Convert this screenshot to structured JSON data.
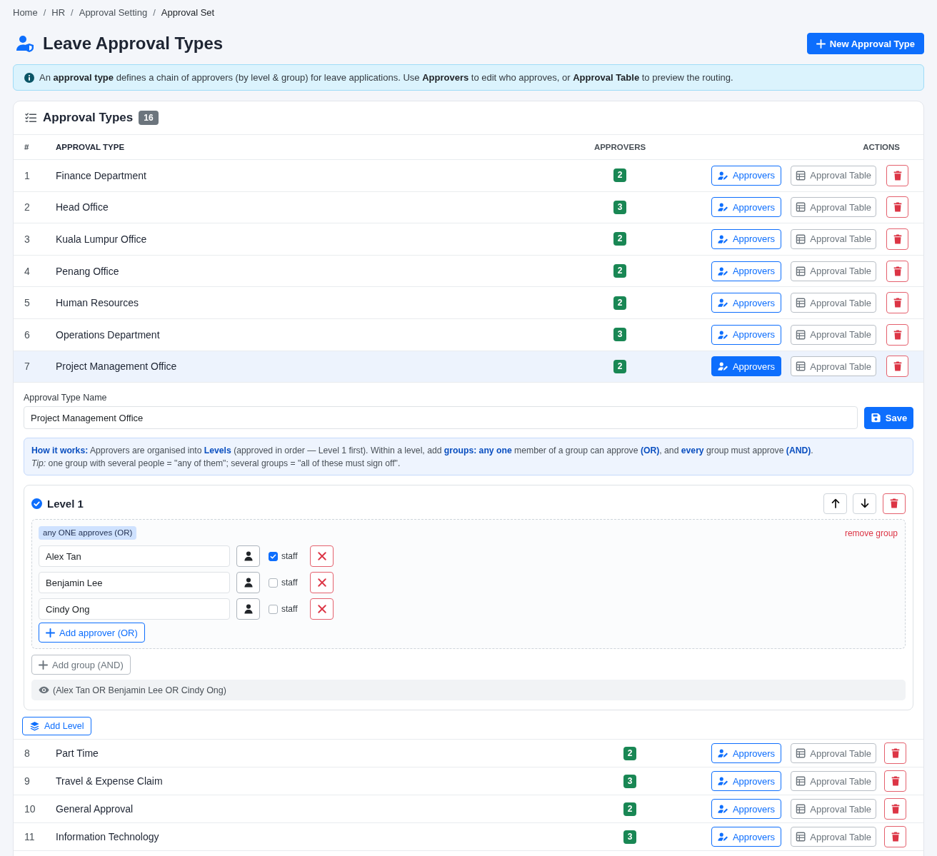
{
  "breadcrumb": {
    "items": [
      "Home",
      "HR",
      "Approval Setting",
      "Approval Set"
    ],
    "separators": [
      "/",
      "/",
      "/"
    ]
  },
  "header": {
    "title": "Leave Approval Types",
    "new_button": "New Approval Type"
  },
  "info_alert": "An **approval type** defines a chain of approvers (by level & group) for leave applications. Use **Approvers** to edit who approves, or **Approval Table** to preview the routing.",
  "card": {
    "title": "Approval Types",
    "count": "16"
  },
  "table": {
    "columns": [
      "#",
      "APPROVAL TYPE",
      "APPROVERS",
      "ACTIONS"
    ],
    "rows": [
      {
        "number": "1",
        "name": "Finance Department",
        "approvers": "2",
        "approvers_button": "Approvers",
        "table_button": "Approval Table",
        "selected": false
      },
      {
        "number": "2",
        "name": "Head Office",
        "approvers": "3",
        "approvers_button": "Approvers",
        "table_button": "Approval Table",
        "selected": false
      },
      {
        "number": "3",
        "name": "Kuala Lumpur Office",
        "approvers": "2",
        "approvers_button": "Approvers",
        "table_button": "Approval Table",
        "selected": false
      },
      {
        "number": "4",
        "name": "Penang Office",
        "approvers": "2",
        "approvers_button": "Approvers",
        "table_button": "Approval Table",
        "selected": false
      },
      {
        "number": "5",
        "name": "Human Resources",
        "approvers": "2",
        "approvers_button": "Approvers",
        "table_button": "Approval Table",
        "selected": false
      },
      {
        "number": "6",
        "name": "Operations Department",
        "approvers": "3",
        "approvers_button": "Approvers",
        "table_button": "Approval Table",
        "selected": false
      },
      {
        "number": "7",
        "name": "Project Management Office",
        "approvers": "2",
        "approvers_button": "Approvers",
        "table_button": "Approval Table",
        "selected": true
      },
      {
        "number": "8",
        "name": "Part Time",
        "approvers": "2",
        "approvers_button": "Approvers",
        "table_button": "Approval Table",
        "selected": false
      },
      {
        "number": "9",
        "name": "Travel & Expense Claim",
        "approvers": "3",
        "approvers_button": "Approvers",
        "table_button": "Approval Table",
        "selected": false
      },
      {
        "number": "10",
        "name": "General Approval",
        "approvers": "2",
        "approvers_button": "Approvers",
        "table_button": "Approval Table",
        "selected": false
      },
      {
        "number": "11",
        "name": "Information Technology",
        "approvers": "3",
        "approvers_button": "Approvers",
        "table_button": "Approval Table",
        "selected": false
      }
    ]
  },
  "editor": {
    "name_label": "Approval Type Name",
    "name_value": "Project Management Office",
    "save_button": "Save",
    "how_it_works": "**How it works:** Approvers are organised into **Levels** (approved in order — Level 1 first). Within a level, add **groups: any one** member of a group can approve **(OR)**, and **every** group must approve **(AND)**.",
    "tip": "*Tip:* one group with several people = \"any of them\"; several groups = \"all of these must sign off\".",
    "levels": [
      {
        "title": "Level 1",
        "groups": [
          {
            "rule": "any ONE approves (OR)",
            "remove_link": "remove group",
            "approvers": [
              {
                "name": "Alex Tan",
                "checked": true,
                "checkbox_label": "staff"
              },
              {
                "name": "Benjamin Lee",
                "checked": false,
                "checkbox_label": "staff"
              },
              {
                "name": "Cindy Ong",
                "checked": false,
                "checkbox_label": "staff"
              }
            ],
            "add_approver_button": "Add approver (OR)"
          }
        ],
        "add_group_button": "Add group (AND)",
        "preview": "(Alex Tan OR Benjamin Lee OR Cindy Ong)"
      }
    ],
    "add_level_button": "Add Level"
  }
}
